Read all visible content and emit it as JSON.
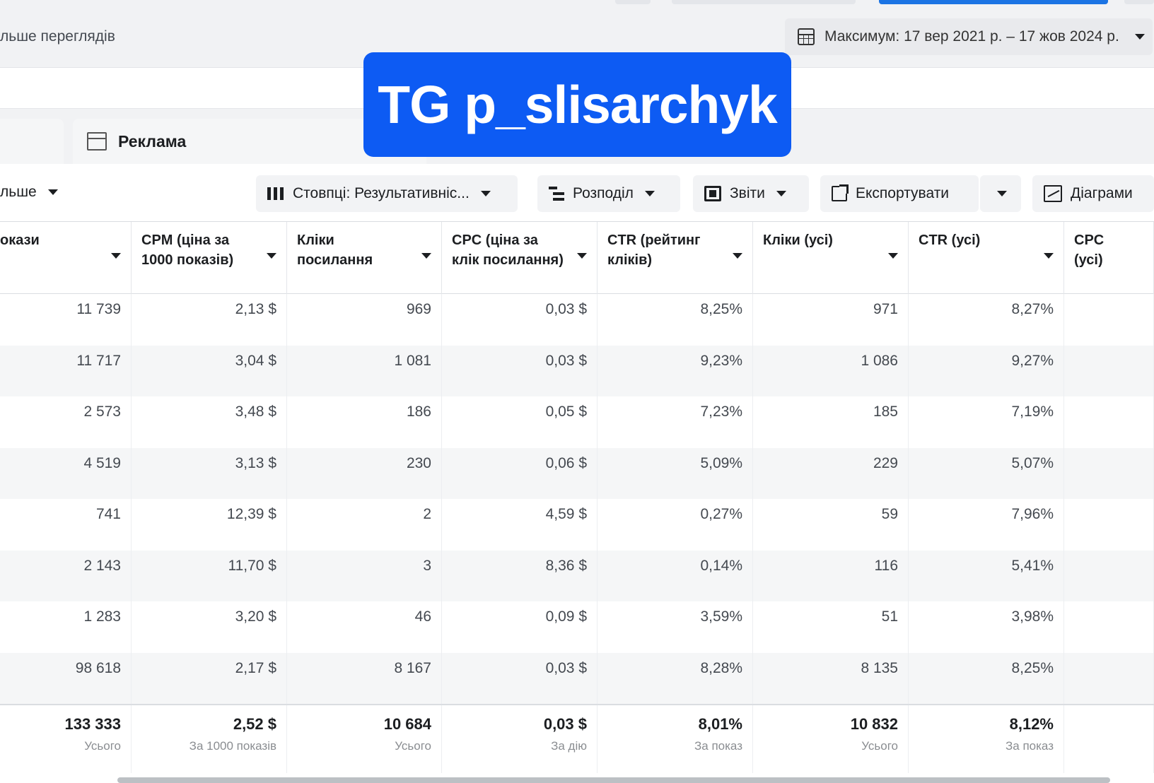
{
  "topbar": {
    "views_text": "льше переглядів",
    "date_range_label": "Максимум: 17 вер 2021 р. – 17 жов 2024 р."
  },
  "tabs": {
    "ads_label": "Реклама"
  },
  "watermark": {
    "text": "TG p_slisarchyk",
    "color": "#0d5bf3"
  },
  "toolbar": {
    "more_label": "льше",
    "columns_label": "Стовпці: Результативніс...",
    "breakdown_label": "Розподіл",
    "reports_label": "Звіти",
    "export_label": "Експортувати",
    "charts_label": "Діаграми",
    "icons": [
      "columns-icon",
      "breakdown-icon",
      "reports-icon",
      "export-icon",
      "charts-icon"
    ]
  },
  "table": {
    "columns": [
      {
        "key": "impressions",
        "label": "окази"
      },
      {
        "key": "cpm",
        "label": "CPM (ціна за 1000 показів)"
      },
      {
        "key": "link_clicks",
        "label": "Кліки посилання"
      },
      {
        "key": "cpc_link",
        "label": "CPC (ціна за клік посилання)"
      },
      {
        "key": "ctr_link",
        "label": "CTR (рейтинг кліків)"
      },
      {
        "key": "clicks_all",
        "label": "Кліки (усі)"
      },
      {
        "key": "ctr_all",
        "label": "CTR (усі)"
      },
      {
        "key": "cpc_all",
        "label": "CPC (усі)"
      }
    ],
    "rows": [
      [
        "11 739",
        "2,13 $",
        "969",
        "0,03 $",
        "8,25%",
        "971",
        "8,27%",
        ""
      ],
      [
        "11 717",
        "3,04 $",
        "1 081",
        "0,03 $",
        "9,23%",
        "1 086",
        "9,27%",
        ""
      ],
      [
        "2 573",
        "3,48 $",
        "186",
        "0,05 $",
        "7,23%",
        "185",
        "7,19%",
        ""
      ],
      [
        "4 519",
        "3,13 $",
        "230",
        "0,06 $",
        "5,09%",
        "229",
        "5,07%",
        ""
      ],
      [
        "741",
        "12,39 $",
        "2",
        "4,59 $",
        "0,27%",
        "59",
        "7,96%",
        ""
      ],
      [
        "2 143",
        "11,70 $",
        "3",
        "8,36 $",
        "0,14%",
        "116",
        "5,41%",
        ""
      ],
      [
        "1 283",
        "3,20 $",
        "46",
        "0,09 $",
        "3,59%",
        "51",
        "3,98%",
        ""
      ],
      [
        "98 618",
        "2,17 $",
        "8 167",
        "0,03 $",
        "8,28%",
        "8 135",
        "8,25%",
        ""
      ]
    ],
    "totals": [
      {
        "value": "133 333",
        "sub": "Усього"
      },
      {
        "value": "2,52 $",
        "sub": "За 1000 показів"
      },
      {
        "value": "10 684",
        "sub": "Усього"
      },
      {
        "value": "0,03 $",
        "sub": "За дію"
      },
      {
        "value": "8,01%",
        "sub": "За показ"
      },
      {
        "value": "10 832",
        "sub": "Усього"
      },
      {
        "value": "8,12%",
        "sub": "За показ"
      },
      {
        "value": "",
        "sub": ""
      }
    ]
  }
}
